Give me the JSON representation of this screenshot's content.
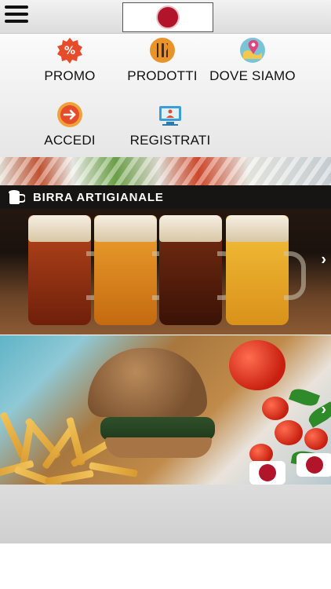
{
  "header": {
    "menu_icon": "hamburger-menu-icon",
    "logo": "pizza-logo"
  },
  "menu": {
    "items": [
      {
        "label": "PROMO",
        "icon": "percent-badge-icon",
        "color": "#e64b2a"
      },
      {
        "label": "PRODOTTI",
        "icon": "cutlery-icon",
        "color": "#e8942b"
      },
      {
        "label": "DOVE SIAMO",
        "icon": "map-pin-icon",
        "color": "#7bc4d8"
      },
      {
        "label": "ACCEDI",
        "icon": "login-arrow-icon",
        "color": "#e64b2a"
      },
      {
        "label": "REGISTRATI",
        "icon": "register-computer-icon",
        "color": "#3a9fd8"
      }
    ]
  },
  "banners": {
    "beer": {
      "title": "BIRRA ARTIGIANALE",
      "icon": "beer-mug-icon",
      "next_icon": "chevron-right-icon"
    },
    "burger": {
      "next_icon": "chevron-right-icon"
    }
  }
}
